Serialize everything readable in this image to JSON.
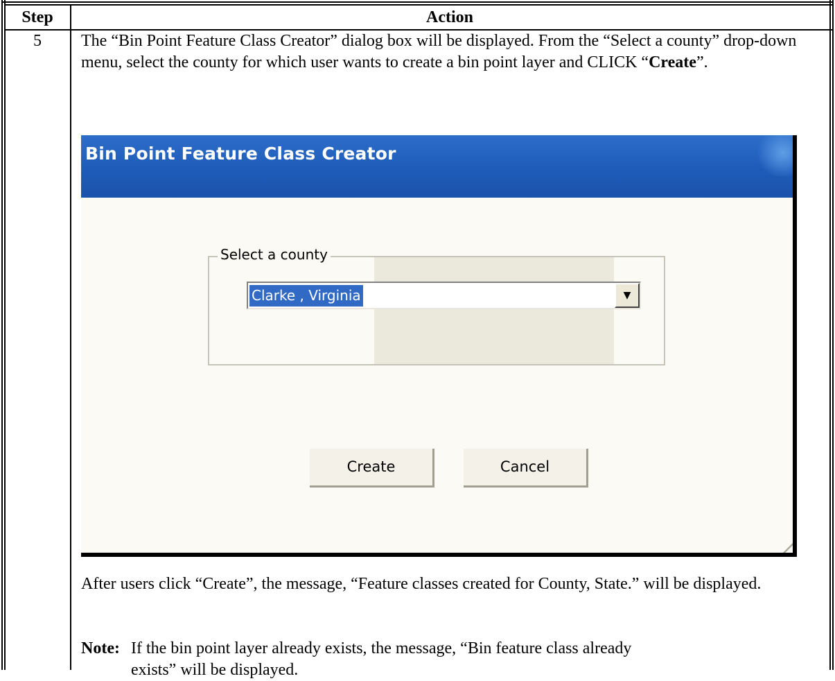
{
  "table": {
    "header_step": "Step",
    "header_action": "Action",
    "step_number": "5"
  },
  "paragraph_1_text": "The “Bin Point Feature Class Creator” dialog box will be displayed.  From the “Select a county” drop-down menu, select the county for which user wants to create a bin point layer and CLICK “",
  "paragraph_1_bold": "Create",
  "paragraph_1_end": "”.",
  "dialog": {
    "title": "Bin Point Feature Class Creator",
    "group_label": "Select a county",
    "county_value": "Clarke , Virginia",
    "dropdown_arrow": "▼",
    "create_label": "Create",
    "cancel_label": "Cancel"
  },
  "paragraph_2": "After users click “Create”, the message, “Feature classes created for County, State.” will be displayed.",
  "note": {
    "label": "Note:",
    "text_line1": "If the bin point layer already exists, the message, “Bin feature class already",
    "text_line2": "exists” will be displayed."
  }
}
